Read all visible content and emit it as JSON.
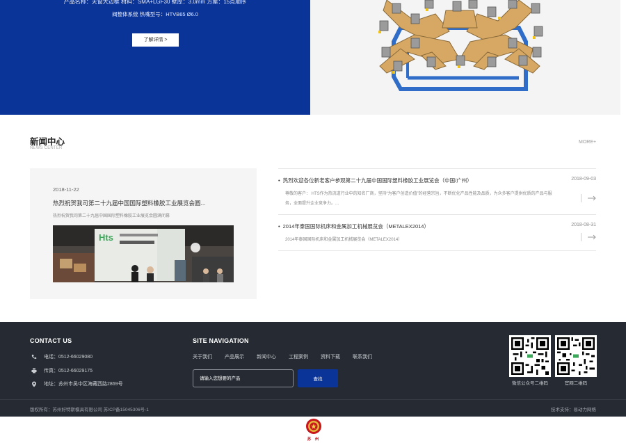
{
  "hero": {
    "line1": "产品名称：天窗大边框 材料：SMA+LGF30 壁厚：3.0mm 方案：15点顺序",
    "line2": "阀整体系统 热嘴型号：HTVB65 Ø6.0",
    "button_label": "了解详情 >",
    "colors": {
      "left_bg": "#0a3497",
      "right_bg": "#f4f4f4"
    }
  },
  "news": {
    "title": "新闻中心",
    "subtitle": "NEWS CENTER",
    "more_label": "MORE+",
    "featured": {
      "date": "2018-11-22",
      "title": "热烈祝贺我司第二十九届中国国际塑料橡胶工业展览会圆...",
      "description": "热烈祝贺我司第二十九届中国国际塑料橡胶工业展览会圆满闭幕"
    },
    "items": [
      {
        "title": "热烈欢迎各位新老客户参观第二十九届中国国际塑料橡胶工业展览会（中国/广州）",
        "date": "2018-09-03",
        "description": "尊敬的客户： HTS作为热流道行业中的知名厂商，坚持“为客户创造价值”的经营宗旨，不断优化产品性能及品质，为众多客户提供优质的产品与服务，全面提升企业竞争力。..."
      },
      {
        "title": "2014年泰国国际机床和金属加工机械展览会（METALEX2014）",
        "date": "2018-08-31",
        "description": "2014年泰国国际机床和金属加工机械展览会（METALEX2014）"
      }
    ]
  },
  "footer": {
    "contact_heading": "CONTACT US",
    "phone": "电话：0512-66029080",
    "fax": "传真：0512-66029175",
    "address": "地址：苏州市吴中区海藏西路2869号",
    "nav_heading": "SITE NAVIGATION",
    "nav_links": [
      "关于我们",
      "产品展示",
      "新闻中心",
      "工程案例",
      "资料下载",
      "联系我们"
    ],
    "search_placeholder": "请输入您想要的产品",
    "search_button": "查找",
    "qr_labels": [
      "微信公众号二维码",
      "官网二维码"
    ],
    "copyright": "版权所有：苏州好特斯模具有限公司   苏ICP备15045306号-1",
    "tech_support": "技术支持：易动力网络",
    "colors": {
      "bg": "#262b33",
      "accent": "#0a3497"
    }
  },
  "emblem": {
    "label": "苏 州"
  }
}
